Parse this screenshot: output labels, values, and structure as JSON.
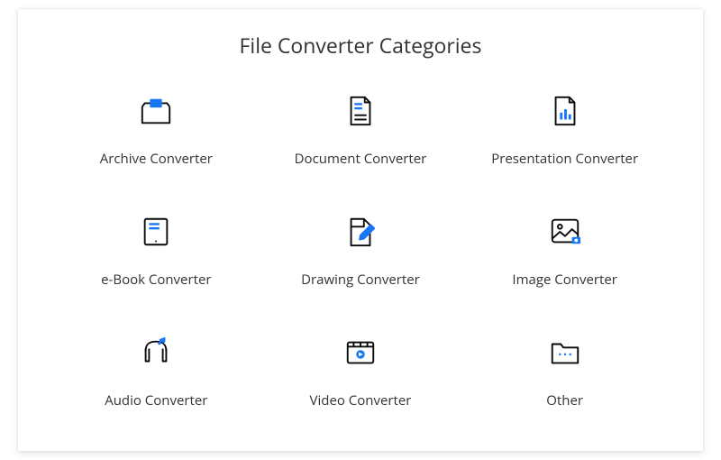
{
  "title": "File Converter Categories",
  "categories": [
    {
      "label": "Archive Converter",
      "icon": "archive"
    },
    {
      "label": "Document Converter",
      "icon": "document"
    },
    {
      "label": "Presentation Converter",
      "icon": "presentation"
    },
    {
      "label": "e-Book Converter",
      "icon": "ebook"
    },
    {
      "label": "Drawing Converter",
      "icon": "drawing"
    },
    {
      "label": "Image Converter",
      "icon": "image"
    },
    {
      "label": "Audio Converter",
      "icon": "audio"
    },
    {
      "label": "Video Converter",
      "icon": "video"
    },
    {
      "label": "Other",
      "icon": "other"
    }
  ],
  "colors": {
    "accent": "#1877F2",
    "stroke": "#0a0a0a"
  }
}
